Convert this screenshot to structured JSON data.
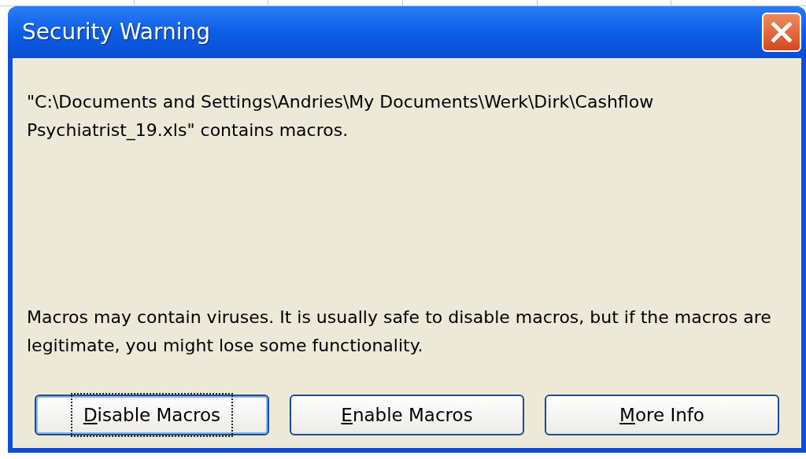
{
  "window": {
    "title": "Security Warning"
  },
  "message": "\"C:\\Documents and Settings\\Andries\\My Documents\\Werk\\Dirk\\Cashflow Psychiatrist_19.xls\" contains macros.",
  "warning": "Macros may contain viruses. It is usually safe to disable macros, but if the macros are legitimate, you might lose some functionality.",
  "buttons": [
    {
      "label": "Disable Macros",
      "focused": true
    },
    {
      "label": "Enable Macros",
      "focused": false
    },
    {
      "label": "More Info",
      "focused": false
    }
  ]
}
